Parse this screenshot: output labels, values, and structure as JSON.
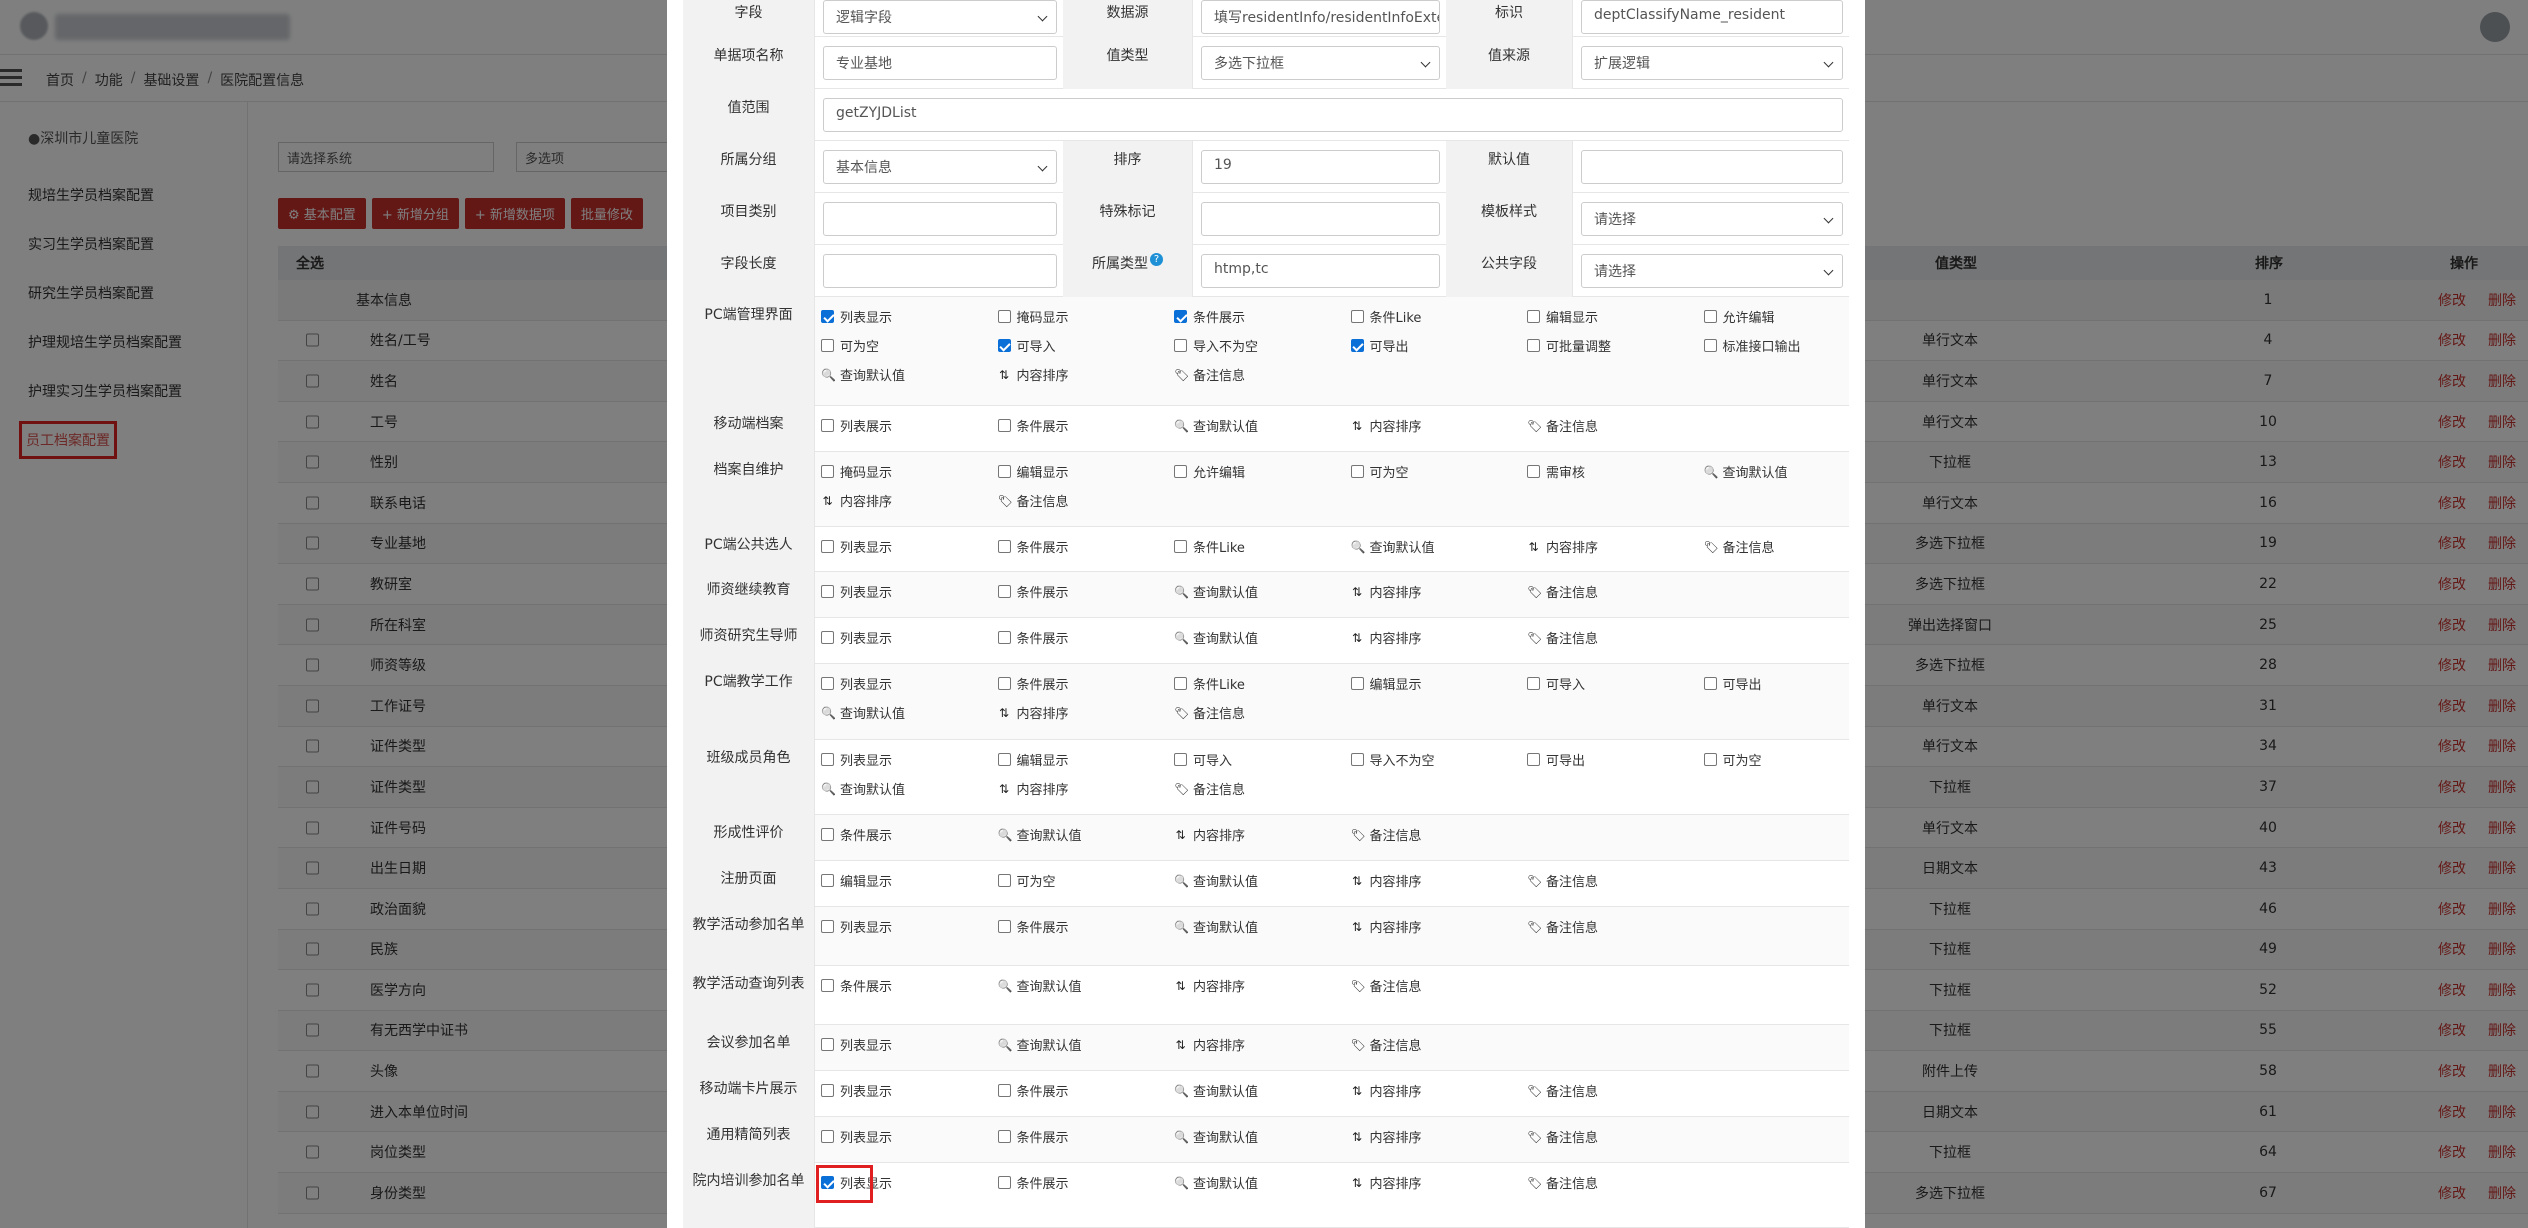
{
  "breadcrumb": [
    "首页",
    "功能",
    "基础设置",
    "医院配置信息"
  ],
  "hospital": "●深圳市儿童医院",
  "sidebar": {
    "items": [
      {
        "label": "规培生学员档案配置"
      },
      {
        "label": "实习生学员档案配置"
      },
      {
        "label": "研究生学员档案配置"
      },
      {
        "label": "护理规培生学员档案配置"
      },
      {
        "label": "护理实习生学员档案配置"
      },
      {
        "label": "员工档案配置",
        "active": true
      }
    ]
  },
  "filters": {
    "system_placeholder": "请选择系统",
    "multi_placeholder": "多选项"
  },
  "toolbar": {
    "basic": "基本配置",
    "add_group": "新增分组",
    "add_item": "新增数据项",
    "batch": "批量修改"
  },
  "grid": {
    "headers": {
      "select_all": "全选",
      "value_type": "值类型",
      "order": "排序",
      "action": "操作"
    },
    "edit_label": "修改",
    "delete_label": "删除",
    "rows": [
      {
        "name": "基本信息",
        "type": "",
        "order": "1",
        "group": true
      },
      {
        "name": "姓名/工号",
        "type": "单行文本",
        "order": "4"
      },
      {
        "name": "姓名",
        "type": "单行文本",
        "order": "7"
      },
      {
        "name": "工号",
        "type": "单行文本",
        "order": "10"
      },
      {
        "name": "性别",
        "type": "下拉框",
        "order": "13"
      },
      {
        "name": "联系电话",
        "type": "单行文本",
        "order": "16"
      },
      {
        "name": "专业基地",
        "type": "多选下拉框",
        "order": "19"
      },
      {
        "name": "教研室",
        "type": "多选下拉框",
        "order": "22"
      },
      {
        "name": "所在科室",
        "type": "弹出选择窗口",
        "order": "25"
      },
      {
        "name": "师资等级",
        "type": "多选下拉框",
        "order": "28"
      },
      {
        "name": "工作证号",
        "type": "单行文本",
        "order": "31"
      },
      {
        "name": "证件类型",
        "type": "单行文本",
        "order": "34"
      },
      {
        "name": "证件类型",
        "type": "下拉框",
        "order": "37"
      },
      {
        "name": "证件号码",
        "type": "单行文本",
        "order": "40"
      },
      {
        "name": "出生日期",
        "type": "日期文本",
        "order": "43"
      },
      {
        "name": "政治面貌",
        "type": "下拉框",
        "order": "46"
      },
      {
        "name": "民族",
        "type": "下拉框",
        "order": "49"
      },
      {
        "name": "医学方向",
        "type": "下拉框",
        "order": "52"
      },
      {
        "name": "有无西学中证书",
        "type": "下拉框",
        "order": "55"
      },
      {
        "name": "头像",
        "type": "附件上传",
        "order": "58"
      },
      {
        "name": "进入本单位时间",
        "type": "日期文本",
        "order": "61"
      },
      {
        "name": "岗位类型",
        "type": "下拉框",
        "order": "64"
      },
      {
        "name": "身份类型",
        "type": "多选下拉框",
        "order": "67"
      }
    ]
  },
  "modal": {
    "form": {
      "field_label": "字段",
      "field_value": "逻辑字段",
      "datasource_label": "数据源",
      "datasource_value": "填写residentInfo/residentInfoExter",
      "key_label": "标识",
      "key_value": "deptClassifyName_resident",
      "itemname_label": "单据项名称",
      "itemname_value": "专业基地",
      "valuetype_label": "值类型",
      "valuetype_value": "多选下拉框",
      "valuesource_label": "值来源",
      "valuesource_value": "扩展逻辑",
      "range_label": "值范围",
      "range_value": "getZYJDList",
      "group_label": "所属分组",
      "group_value": "基本信息",
      "order_label": "排序",
      "order_value": "19",
      "default_label": "默认值",
      "default_value": "",
      "itemclass_label": "项目类别",
      "itemclass_value": "",
      "special_label": "特殊标记",
      "special_value": "",
      "template_label": "模板样式",
      "template_value": "请选择",
      "length_label": "字段长度",
      "length_value": "",
      "ctype_label": "所属类型",
      "ctype_value": "htmp,tc",
      "public_label": "公共字段",
      "public_value": "请选择"
    },
    "sections": [
      {
        "label": "PC端管理界面",
        "opts": [
          {
            "t": "列表显示",
            "k": "cb",
            "on": true
          },
          {
            "t": "掩码显示",
            "k": "cb"
          },
          {
            "t": "条件展示",
            "k": "cb",
            "on": true
          },
          {
            "t": "条件Like",
            "k": "cb"
          },
          {
            "t": "编辑显示",
            "k": "cb"
          },
          {
            "t": "允许编辑",
            "k": "cb"
          },
          {
            "t": "可为空",
            "k": "cb"
          },
          {
            "t": "可导入",
            "k": "cb",
            "on": true
          },
          {
            "t": "导入不为空",
            "k": "cb"
          },
          {
            "t": "可导出",
            "k": "cb",
            "on": true
          },
          {
            "t": "可批量调整",
            "k": "cb"
          },
          {
            "t": "标准接口输出",
            "k": "cb"
          },
          {
            "t": "查询默认值",
            "k": "search"
          },
          {
            "t": "内容排序",
            "k": "sort"
          },
          {
            "t": "备注信息",
            "k": "tag"
          }
        ]
      },
      {
        "label": "移动端档案",
        "opts": [
          {
            "t": "列表展示",
            "k": "cb"
          },
          {
            "t": "条件展示",
            "k": "cb"
          },
          {
            "t": "查询默认值",
            "k": "search"
          },
          {
            "t": "内容排序",
            "k": "sort"
          },
          {
            "t": "备注信息",
            "k": "tag"
          }
        ]
      },
      {
        "label": "档案自维护",
        "opts": [
          {
            "t": "掩码显示",
            "k": "cb"
          },
          {
            "t": "编辑显示",
            "k": "cb"
          },
          {
            "t": "允许编辑",
            "k": "cb"
          },
          {
            "t": "可为空",
            "k": "cb"
          },
          {
            "t": "需审核",
            "k": "cb"
          },
          {
            "t": "查询默认值",
            "k": "search"
          },
          {
            "t": "内容排序",
            "k": "sort"
          },
          {
            "t": "备注信息",
            "k": "tag"
          }
        ]
      },
      {
        "label": "PC端公共选人",
        "opts": [
          {
            "t": "列表显示",
            "k": "cb"
          },
          {
            "t": "条件展示",
            "k": "cb"
          },
          {
            "t": "条件Like",
            "k": "cb"
          },
          {
            "t": "查询默认值",
            "k": "search"
          },
          {
            "t": "内容排序",
            "k": "sort"
          },
          {
            "t": "备注信息",
            "k": "tag"
          }
        ]
      },
      {
        "label": "师资继续教育",
        "opts": [
          {
            "t": "列表显示",
            "k": "cb"
          },
          {
            "t": "条件展示",
            "k": "cb"
          },
          {
            "t": "查询默认值",
            "k": "search"
          },
          {
            "t": "内容排序",
            "k": "sort"
          },
          {
            "t": "备注信息",
            "k": "tag"
          }
        ]
      },
      {
        "label": "师资研究生导师",
        "opts": [
          {
            "t": "列表显示",
            "k": "cb"
          },
          {
            "t": "条件展示",
            "k": "cb"
          },
          {
            "t": "查询默认值",
            "k": "search"
          },
          {
            "t": "内容排序",
            "k": "sort"
          },
          {
            "t": "备注信息",
            "k": "tag"
          }
        ]
      },
      {
        "label": "PC端教学工作",
        "opts": [
          {
            "t": "列表显示",
            "k": "cb"
          },
          {
            "t": "条件展示",
            "k": "cb"
          },
          {
            "t": "条件Like",
            "k": "cb"
          },
          {
            "t": "编辑显示",
            "k": "cb"
          },
          {
            "t": "可导入",
            "k": "cb"
          },
          {
            "t": "可导出",
            "k": "cb"
          },
          {
            "t": "查询默认值",
            "k": "search"
          },
          {
            "t": "内容排序",
            "k": "sort"
          },
          {
            "t": "备注信息",
            "k": "tag"
          }
        ]
      },
      {
        "label": "班级成员角色",
        "opts": [
          {
            "t": "列表显示",
            "k": "cb"
          },
          {
            "t": "编辑显示",
            "k": "cb"
          },
          {
            "t": "可导入",
            "k": "cb"
          },
          {
            "t": "导入不为空",
            "k": "cb"
          },
          {
            "t": "可导出",
            "k": "cb"
          },
          {
            "t": "可为空",
            "k": "cb"
          },
          {
            "t": "查询默认值",
            "k": "search"
          },
          {
            "t": "内容排序",
            "k": "sort"
          },
          {
            "t": "备注信息",
            "k": "tag"
          }
        ]
      },
      {
        "label": "形成性评价",
        "opts": [
          {
            "t": "条件展示",
            "k": "cb"
          },
          {
            "t": "查询默认值",
            "k": "search"
          },
          {
            "t": "内容排序",
            "k": "sort"
          },
          {
            "t": "备注信息",
            "k": "tag"
          }
        ]
      },
      {
        "label": "注册页面",
        "opts": [
          {
            "t": "编辑显示",
            "k": "cb"
          },
          {
            "t": "可为空",
            "k": "cb"
          },
          {
            "t": "查询默认值",
            "k": "search"
          },
          {
            "t": "内容排序",
            "k": "sort"
          },
          {
            "t": "备注信息",
            "k": "tag"
          }
        ]
      },
      {
        "label": "教学活动参加名单",
        "opts": [
          {
            "t": "列表显示",
            "k": "cb"
          },
          {
            "t": "条件展示",
            "k": "cb"
          },
          {
            "t": "查询默认值",
            "k": "search"
          },
          {
            "t": "内容排序",
            "k": "sort"
          },
          {
            "t": "备注信息",
            "k": "tag"
          }
        ]
      },
      {
        "label": "教学活动查询列表",
        "opts": [
          {
            "t": "条件展示",
            "k": "cb"
          },
          {
            "t": "查询默认值",
            "k": "search"
          },
          {
            "t": "内容排序",
            "k": "sort"
          },
          {
            "t": "备注信息",
            "k": "tag"
          }
        ]
      },
      {
        "label": "会议参加名单",
        "opts": [
          {
            "t": "列表显示",
            "k": "cb"
          },
          {
            "t": "查询默认值",
            "k": "search"
          },
          {
            "t": "内容排序",
            "k": "sort"
          },
          {
            "t": "备注信息",
            "k": "tag"
          }
        ]
      },
      {
        "label": "移动端卡片展示",
        "opts": [
          {
            "t": "列表显示",
            "k": "cb"
          },
          {
            "t": "条件展示",
            "k": "cb"
          },
          {
            "t": "查询默认值",
            "k": "search"
          },
          {
            "t": "内容排序",
            "k": "sort"
          },
          {
            "t": "备注信息",
            "k": "tag"
          }
        ]
      },
      {
        "label": "通用精简列表",
        "opts": [
          {
            "t": "列表显示",
            "k": "cb"
          },
          {
            "t": "条件展示",
            "k": "cb"
          },
          {
            "t": "查询默认值",
            "k": "search"
          },
          {
            "t": "内容排序",
            "k": "sort"
          },
          {
            "t": "备注信息",
            "k": "tag"
          }
        ]
      },
      {
        "label": "院内培训参加名单",
        "opts": [
          {
            "t": "列表显示",
            "k": "cb",
            "on": true
          },
          {
            "t": "条件展示",
            "k": "cb"
          },
          {
            "t": "查询默认值",
            "k": "search"
          },
          {
            "t": "内容排序",
            "k": "sort"
          },
          {
            "t": "备注信息",
            "k": "tag"
          }
        ]
      }
    ]
  },
  "icons": {
    "search": "search-icon",
    "sort": "sort-icon",
    "tag": "tag-icon",
    "help": "help-icon"
  },
  "colors": {
    "accent_red": "#c9302c",
    "highlight_border": "#e02020",
    "checkbox_on": "#0b6fd8"
  }
}
